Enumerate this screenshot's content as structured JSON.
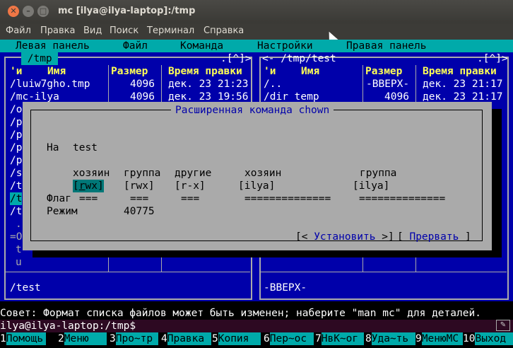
{
  "window": {
    "title": "mc [ilya@ilya-laptop]:/tmp",
    "close_glyph": "✕",
    "min_glyph": "–",
    "max_glyph": "□"
  },
  "menubar": [
    "Файл",
    "Правка",
    "Вид",
    "Поиск",
    "Терминал",
    "Справка"
  ],
  "mc_menu": [
    "Левая панель",
    "Файл",
    "Команда",
    "Настройки",
    "Правая панель"
  ],
  "left_panel": {
    "path": "/tmp",
    "path_suffix": ".[^]>",
    "col_n": "'и",
    "col_name": "Имя",
    "col_size": "Размер",
    "col_time": "Время правки",
    "files": [
      {
        "name": "/luiw7gho.tmp",
        "size": "4096",
        "time": "дек. 23 21:23"
      },
      {
        "name": "/mc-ilya",
        "size": "4096",
        "time": "дек. 23 19:56"
      }
    ],
    "clipped": [
      "/o",
      "/p",
      "/p",
      "/p",
      "/p",
      "/s",
      "/t",
      "/t",
      "/t"
    ],
    "misc": [
      ".",
      "=O",
      "t",
      "u"
    ],
    "footer": "/test"
  },
  "right_panel": {
    "path": "/tmp/test",
    "path_suffix": ".[^]>",
    "col_n": "'и",
    "col_name": "Имя",
    "col_size": "Размер",
    "col_time": "Время правки",
    "files": [
      {
        "name": "/..",
        "size": "-ВВЕРХ-",
        "time": "дек. 23 21:17"
      },
      {
        "name": "/dir_temp",
        "size": "4096",
        "time": "дек. 23 21:17"
      }
    ],
    "footer": "-ВВЕРХ-"
  },
  "dialog": {
    "title": "Расширенная команда chown",
    "on_label": "На",
    "on_value": "test",
    "col_owner": "хозяин",
    "col_group": "группа",
    "col_other": "другие",
    "col_owner2": "хозяин",
    "col_group2": "группа",
    "perm_owner_r": "r",
    "perm_owner_rest": "wx",
    "perm_group": "[rwx]",
    "perm_other": "[r-x]",
    "owner_value": "[ilya]",
    "group_value": "[ilya]",
    "flag_label": "Флаг",
    "flag_owner": "===",
    "flag_group": "===",
    "flag_other": "===",
    "flag_owner2": "==============",
    "flag_group2": "==============",
    "mode_label": "Режим",
    "mode_value": "40775",
    "set_button": "Установить",
    "abort_button": "Прервать"
  },
  "hint": "Совет: Формат списка файлов может быть изменен; наберите \"man mc\" для деталей.",
  "prompt": "ilya@ilya-laptop:/tmp$",
  "fkeys": [
    {
      "n": "1",
      "label": "Помощь"
    },
    {
      "n": "2",
      "label": "Меню"
    },
    {
      "n": "3",
      "label": "Про~тр"
    },
    {
      "n": "4",
      "label": "Правка"
    },
    {
      "n": "5",
      "label": "Копия"
    },
    {
      "n": "6",
      "label": "Пер~ос"
    },
    {
      "n": "7",
      "label": "НвК~ог"
    },
    {
      "n": "8",
      "label": "Уда~ть"
    },
    {
      "n": "9",
      "label": "МенюМС"
    },
    {
      "n": "10",
      "label": "Выход"
    }
  ],
  "corner_button": "✎"
}
